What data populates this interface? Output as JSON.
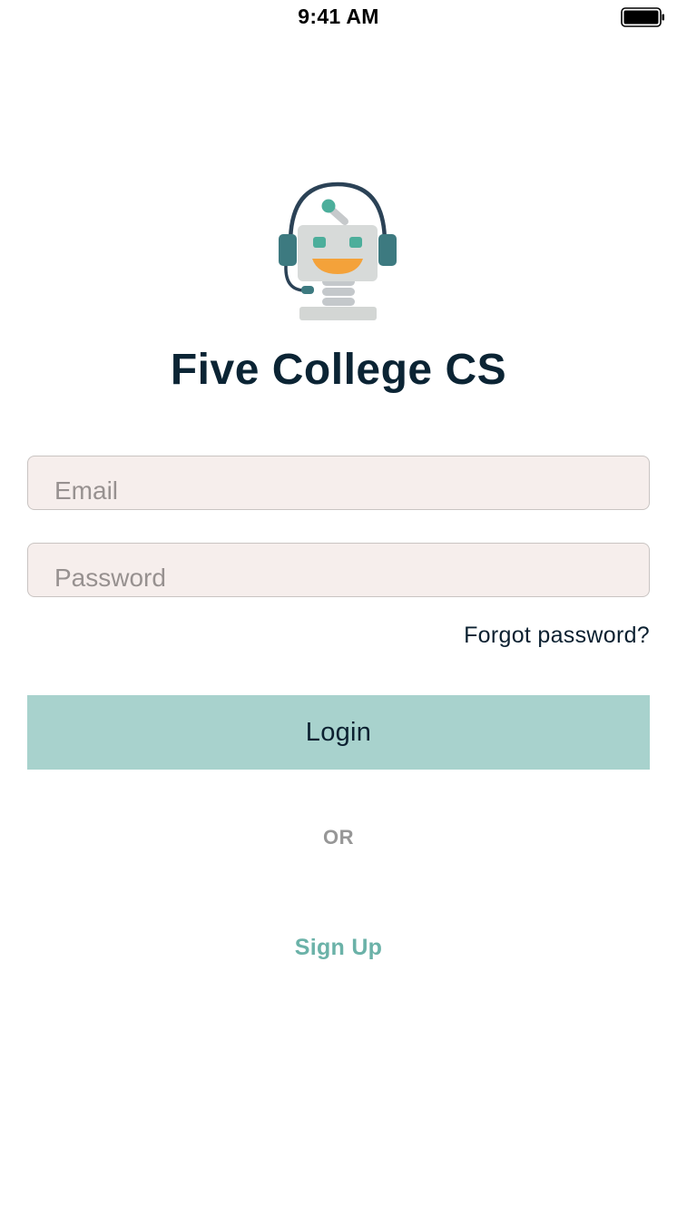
{
  "status_bar": {
    "time": "9:41 AM",
    "battery_icon": "battery-full-icon"
  },
  "app": {
    "logo_icon": "robot-headset-icon",
    "title": "Five College CS"
  },
  "form": {
    "email_placeholder": "Email",
    "email_value": "",
    "password_placeholder": "Password",
    "password_value": "",
    "forgot_label": "Forgot password?",
    "login_label": "Login",
    "or_label": "OR",
    "signup_label": "Sign Up"
  },
  "colors": {
    "title": "#0b2434",
    "field_background": "#f6eeec",
    "login_button": "#a8d2cd",
    "signup_link": "#6bb2a8",
    "or_text": "#979797"
  }
}
